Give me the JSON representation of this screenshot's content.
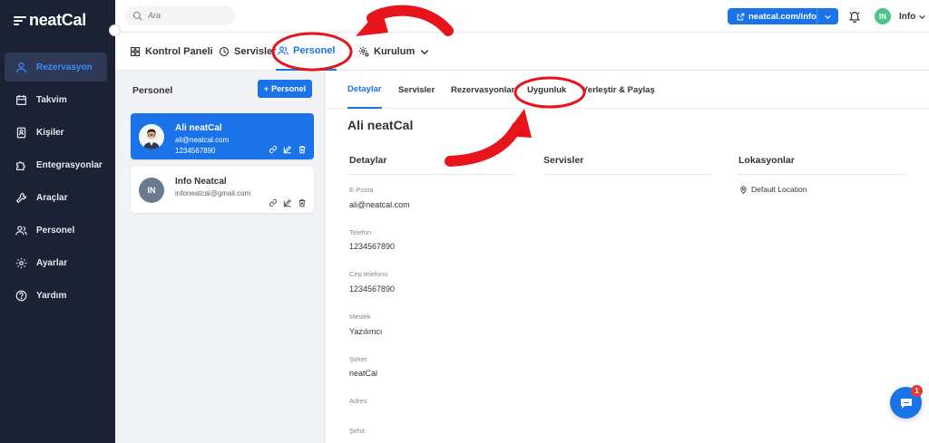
{
  "app": {
    "logo_text": "neatCal"
  },
  "sidebar": {
    "items": [
      {
        "label": "Rezervasyon",
        "icon": "user-icon",
        "active": true
      },
      {
        "label": "Takvim",
        "icon": "calendar-icon"
      },
      {
        "label": "Kişiler",
        "icon": "contacts-icon"
      },
      {
        "label": "Entegrasyonlar",
        "icon": "puzzle-icon"
      },
      {
        "label": "Araçlar",
        "icon": "wrench-icon"
      },
      {
        "label": "Personel",
        "icon": "users-icon"
      },
      {
        "label": "Ayarlar",
        "icon": "gear-icon"
      },
      {
        "label": "Yardım",
        "icon": "help-icon"
      }
    ]
  },
  "topbar": {
    "search_placeholder": "Ara",
    "url_label": "neatcal.com/info",
    "avatar_initials": "IN",
    "user_name": "Info"
  },
  "main_tabs": [
    {
      "label": "Kontrol Paneli",
      "icon": "dashboard-icon"
    },
    {
      "label": "Servisler",
      "icon": "clock-icon"
    },
    {
      "label": "Personel",
      "icon": "users-icon",
      "active": true
    },
    {
      "label": "Kurulum",
      "icon": "settings-icon",
      "has_dropdown": true
    }
  ],
  "staff_panel": {
    "title": "Personel",
    "add_button": "Personel",
    "cards": [
      {
        "name": "Ali neatCal",
        "email": "ali@neatcal.com",
        "phone": "1234567890",
        "selected": true
      },
      {
        "name": "Info Neatcal",
        "email": "infoneatcal@gmail.com",
        "initials": "IN"
      }
    ]
  },
  "detail": {
    "sub_tabs": [
      "Detaylar",
      "Servisler",
      "Rezervasyonlar",
      "Uygunluk",
      "Yerleştir & Paylaş"
    ],
    "person_name": "Ali neatCal",
    "columns": [
      "Detaylar",
      "Servisler",
      "Lokasyonlar"
    ],
    "fields": [
      {
        "label": "E-Posta",
        "value": "ali@neatcal.com"
      },
      {
        "label": "Telefon",
        "value": "1234567890"
      },
      {
        "label": "Cep telefonu",
        "value": "1234567890"
      },
      {
        "label": "Meslek",
        "value": "Yazılımcı"
      },
      {
        "label": "Şirket",
        "value": "neatCal"
      },
      {
        "label": "Adres",
        "value": ""
      },
      {
        "label": "Şehir",
        "value": ""
      }
    ],
    "location": "Default Location"
  },
  "chat": {
    "badge": "1"
  },
  "colors": {
    "accent": "#1a73e8",
    "sidebar_bg": "#1b2233",
    "annotation": "#e8141c"
  }
}
